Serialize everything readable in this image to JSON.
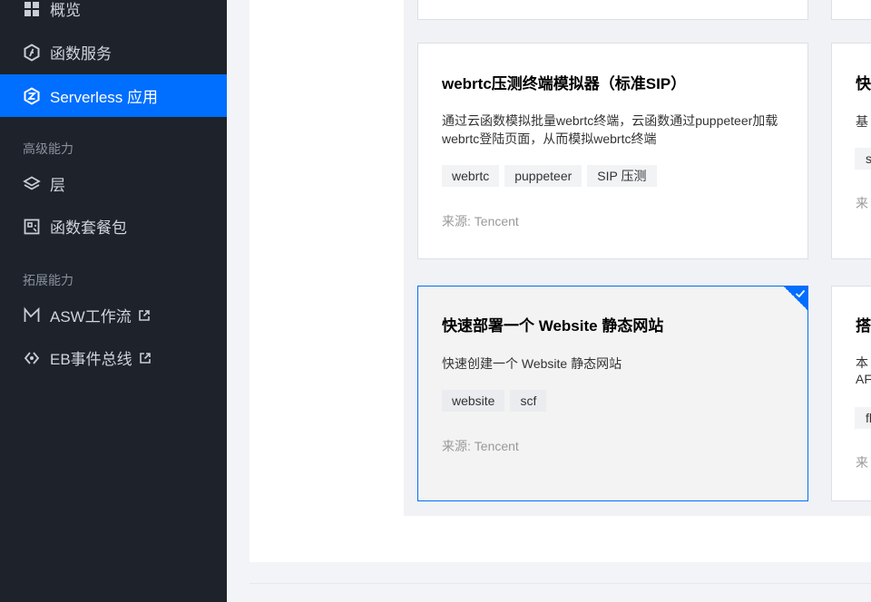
{
  "sidebar": {
    "items": [
      {
        "label": "概览",
        "icon": "grid-icon"
      },
      {
        "label": "函数服务",
        "icon": "function-icon"
      },
      {
        "label": "Serverless 应用",
        "icon": "serverless-app-icon",
        "active": true
      },
      {
        "label": "层",
        "icon": "layers-icon"
      },
      {
        "label": "函数套餐包",
        "icon": "package-icon"
      },
      {
        "label": "ASW工作流",
        "icon": "workflow-icon",
        "external": true
      },
      {
        "label": "EB事件总线",
        "icon": "event-bus-icon",
        "external": true
      }
    ],
    "sections": {
      "advanced": "高级能力",
      "extended": "拓展能力"
    }
  },
  "cards": [
    {
      "title": "webrtc压测终端模拟器（标准SIP）",
      "description": "通过云函数模拟批量webrtc终端，云函数通过puppeteer加载webrtc登陆页面，从而模拟webrtc终端",
      "tags": [
        "webrtc",
        "puppeteer",
        "SIP 压测"
      ],
      "source": "来源: Tencent"
    },
    {
      "title": "快速部署一个 Website 静态网站",
      "description": "快速创建一个 Website 静态网站",
      "tags": [
        "website",
        "scf"
      ],
      "source": "来源: Tencent",
      "selected": true
    }
  ],
  "partial": {
    "card1_title": "快",
    "card1_desc": "基",
    "card1_tag": "s",
    "card1_source": "来",
    "card2_title": "搭",
    "card2_desc1": "本",
    "card2_desc2": "AF",
    "card2_tag": "fl",
    "card2_source": "来"
  },
  "colors": {
    "sidebar_bg": "#1d222b",
    "accent": "#006eff",
    "selected_card_bg": "#f3f3f3"
  }
}
